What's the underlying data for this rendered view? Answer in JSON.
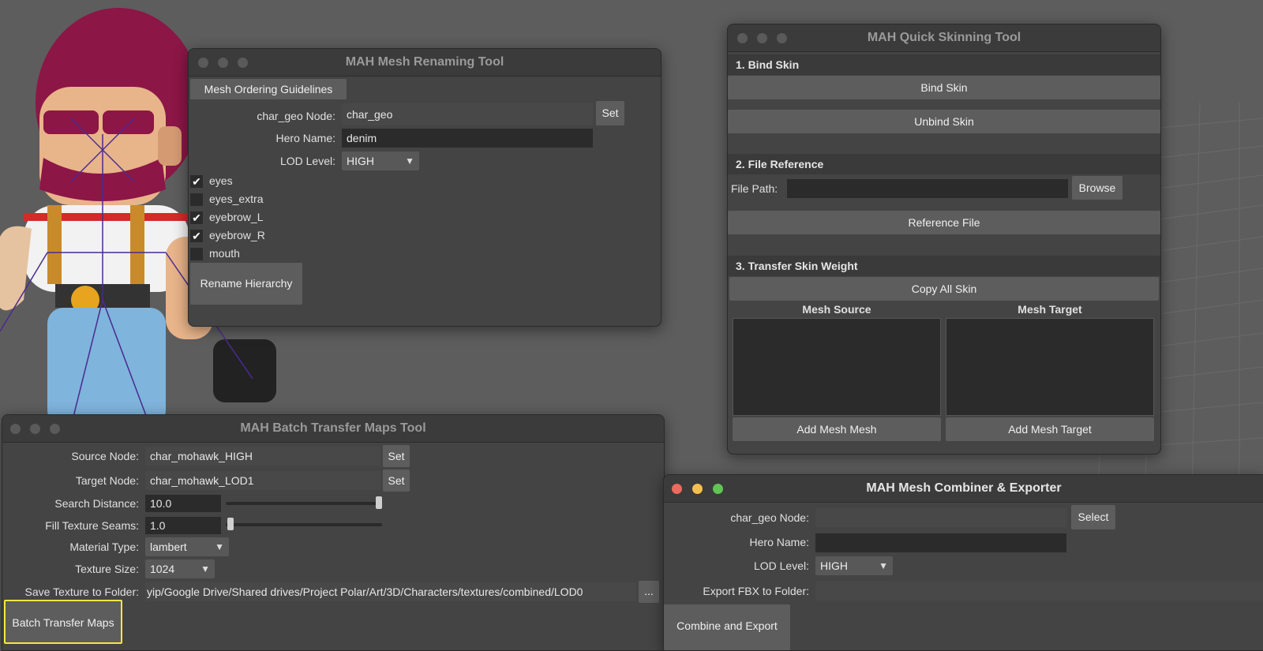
{
  "colors": {
    "viewport_bg": "#5d5d5d",
    "window_bg": "#444444",
    "field_bg": "#2b2b2b",
    "button_bg": "#5d5d5d",
    "highlight": "#f5e642",
    "hair": "#8c1646"
  },
  "renaming_tool": {
    "title": "MAH Mesh Renaming Tool",
    "guidelines_button": "Mesh Ordering Guidelines",
    "char_geo_label": "char_geo Node:",
    "char_geo_value": "char_geo",
    "set_button": "Set",
    "hero_name_label": "Hero Name:",
    "hero_name_value": "denim",
    "lod_label": "LOD Level:",
    "lod_value": "HIGH",
    "checkboxes": [
      {
        "label": "eyes",
        "checked": true
      },
      {
        "label": "eyes_extra",
        "checked": false
      },
      {
        "label": "eyebrow_L",
        "checked": true
      },
      {
        "label": "eyebrow_R",
        "checked": true
      },
      {
        "label": "mouth",
        "checked": false
      }
    ],
    "rename_button": "Rename Hierarchy"
  },
  "skinning_tool": {
    "title": "MAH Quick Skinning Tool",
    "section1": "1. Bind Skin",
    "bind_button": "Bind Skin",
    "unbind_button": "Unbind Skin",
    "section2": "2. File Reference",
    "file_path_label": "File Path:",
    "file_path_value": "",
    "browse_button": "Browse",
    "reference_button": "Reference File",
    "section3": "3. Transfer Skin Weight",
    "copy_button": "Copy All Skin",
    "mesh_source_label": "Mesh Source",
    "mesh_target_label": "Mesh Target",
    "add_source_button": "Add Mesh Mesh",
    "add_target_button": "Add Mesh Target"
  },
  "transfer_tool": {
    "title": "MAH Batch Transfer Maps Tool",
    "source_label": "Source Node:",
    "source_value": "char_mohawk_HIGH",
    "target_label": "Target Node:",
    "target_value": "char_mohawk_LOD1",
    "set_button": "Set",
    "search_label": "Search Distance:",
    "search_value": "10.0",
    "search_slider_level": 1.0,
    "fill_label": "Fill Texture Seams:",
    "fill_value": "1.0",
    "fill_slider_level": 0.0,
    "material_label": "Material Type:",
    "material_value": "lambert",
    "texture_size_label": "Texture Size:",
    "texture_size_value": "1024",
    "save_label": "Save Texture to Folder:",
    "save_value": "yip/Google Drive/Shared drives/Project Polar/Art/3D/Characters/textures/combined/LOD0",
    "browse_button": "...",
    "batch_button": "Batch Transfer Maps"
  },
  "combiner_tool": {
    "title": "MAH Mesh Combiner & Exporter",
    "char_geo_label": "char_geo Node:",
    "char_geo_value": "",
    "select_button": "Select",
    "hero_name_label": "Hero Name:",
    "hero_name_value": "",
    "lod_label": "LOD Level:",
    "lod_value": "HIGH",
    "export_label": "Export FBX to Folder:",
    "export_value": "",
    "combine_button": "Combine and Export"
  }
}
